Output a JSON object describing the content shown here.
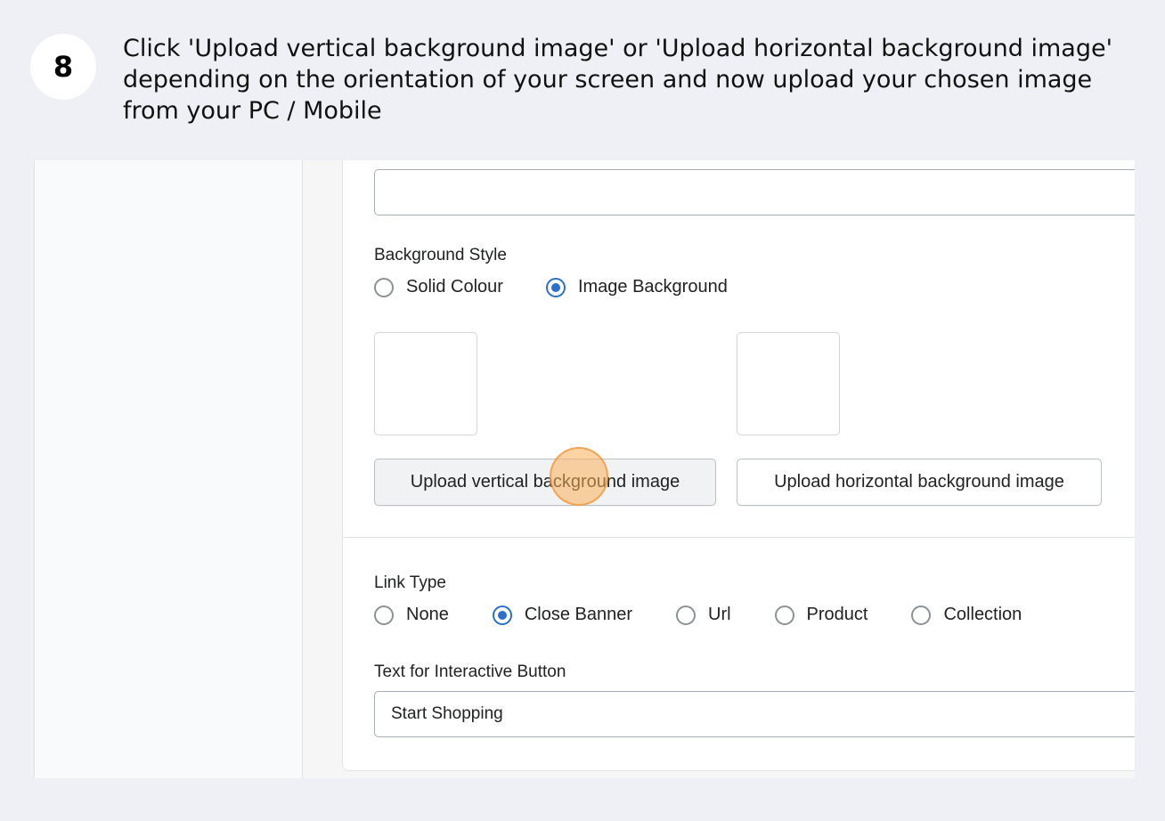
{
  "step": {
    "number": "8",
    "instruction": "Click 'Upload vertical background image' or 'Upload horizontal background image' depending on the orientation of your screen and now upload your chosen image from your PC / Mobile"
  },
  "form": {
    "top_input_value": "",
    "background_style": {
      "label": "Background Style",
      "options": [
        {
          "label": "Solid Colour",
          "checked": false
        },
        {
          "label": "Image Background",
          "checked": true
        }
      ]
    },
    "upload_vertical_label": "Upload vertical background image",
    "upload_horizontal_label": "Upload horizontal background image",
    "link_type": {
      "label": "Link Type",
      "options": [
        {
          "label": "None",
          "checked": false
        },
        {
          "label": "Close Banner",
          "checked": true
        },
        {
          "label": "Url",
          "checked": false
        },
        {
          "label": "Product",
          "checked": false
        },
        {
          "label": "Collection",
          "checked": false
        }
      ]
    },
    "interactive_button": {
      "label": "Text for Interactive Button",
      "value": "Start Shopping"
    }
  },
  "colors": {
    "accent": "#2c6ecb",
    "page_background": "#eef0f5",
    "click_marker": "#fab05a"
  }
}
